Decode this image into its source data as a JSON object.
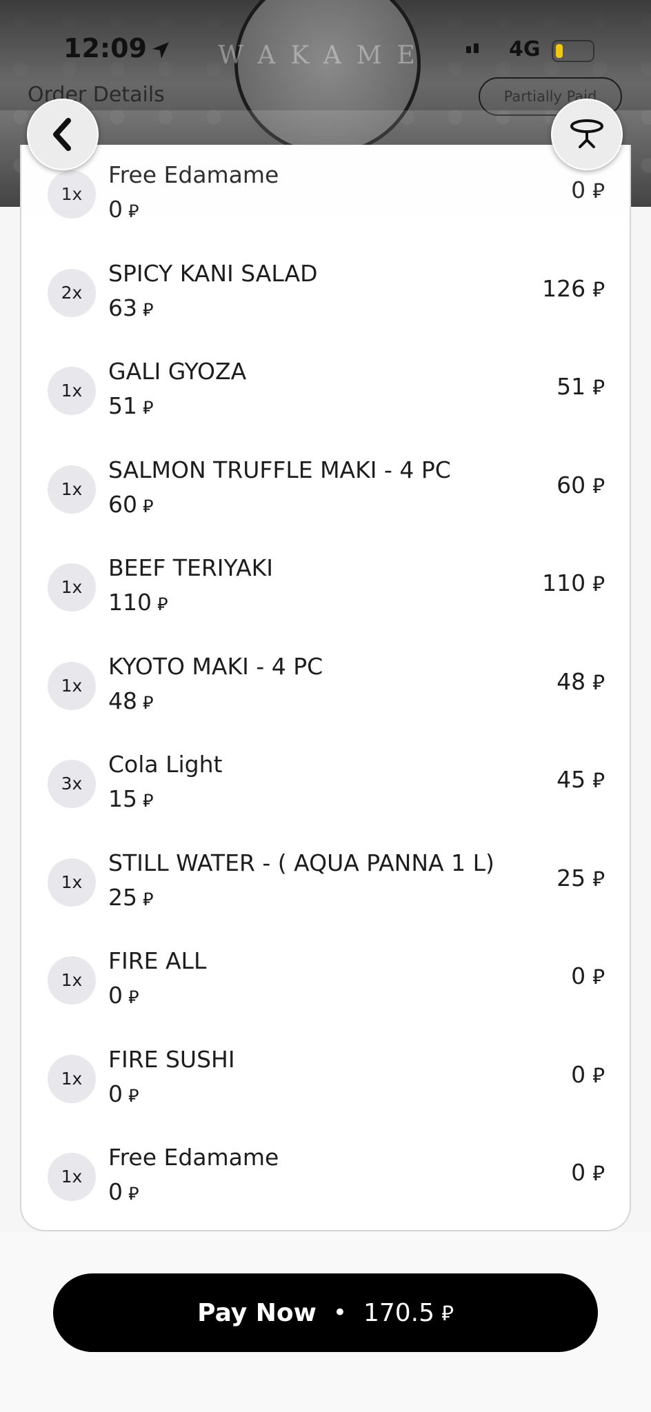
{
  "status_bar": {
    "time": "12:09",
    "network": "4G"
  },
  "header": {
    "title": "Order Details",
    "payment_status": "Partially Paid",
    "logo_text": "WAKAME"
  },
  "currency_symbol": "⃁",
  "items": [
    {
      "qty": "1x",
      "name": "Free Edamame",
      "unit_price": "0",
      "total": "0"
    },
    {
      "qty": "2x",
      "name": "SPICY KANI SALAD",
      "unit_price": "63",
      "total": "126"
    },
    {
      "qty": "1x",
      "name": "GALI GYOZA",
      "unit_price": "51",
      "total": "51"
    },
    {
      "qty": "1x",
      "name": "SALMON TRUFFLE MAKI - 4 PC",
      "unit_price": "60",
      "total": "60"
    },
    {
      "qty": "1x",
      "name": "BEEF TERIYAKI",
      "unit_price": "110",
      "total": "110"
    },
    {
      "qty": "1x",
      "name": "KYOTO MAKI - 4 PC",
      "unit_price": "48",
      "total": "48"
    },
    {
      "qty": "3x",
      "name": "Cola Light",
      "unit_price": "15",
      "total": "45"
    },
    {
      "qty": "1x",
      "name": "STILL WATER - ( AQUA PANNA 1 L)",
      "unit_price": "25",
      "total": "25"
    },
    {
      "qty": "1x",
      "name": "FIRE ALL",
      "unit_price": "0",
      "total": "0"
    },
    {
      "qty": "1x",
      "name": "FIRE SUSHI",
      "unit_price": "0",
      "total": "0"
    },
    {
      "qty": "1x",
      "name": "Free Edamame",
      "unit_price": "0",
      "total": "0"
    }
  ],
  "footer": {
    "pay_label": "Pay Now",
    "separator": "•",
    "amount": "170.5"
  },
  "icons": {
    "back": "chevron-left-icon",
    "table": "table-icon",
    "location": "location-arrow-icon"
  }
}
